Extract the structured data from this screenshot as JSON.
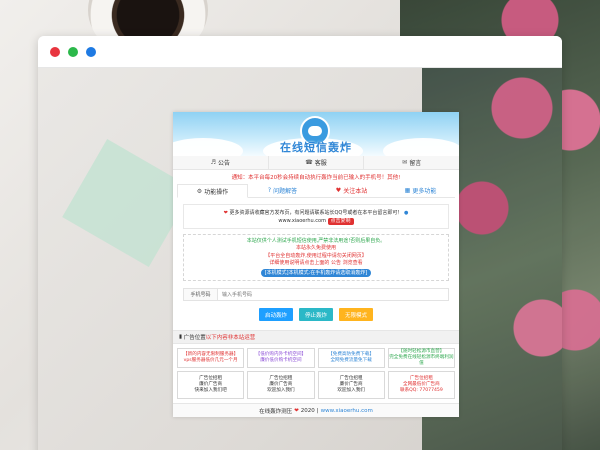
{
  "window": {
    "dots": [
      "#e8353f",
      "#2bb84a",
      "#1e7ae3"
    ]
  },
  "site": {
    "title": "在线短信轰炸",
    "nav": [
      {
        "icon": "megaphone-icon",
        "label": "公告"
      },
      {
        "icon": "headset-icon",
        "label": "客服"
      },
      {
        "icon": "chat-icon",
        "label": "留言"
      }
    ],
    "notice": "通知：本平台每20秒会持续自动执行轰炸当前已输入的手机号！其他!",
    "tabs": [
      {
        "label": "功能操作",
        "icon": "gear-icon"
      },
      {
        "label": "问题解答",
        "icon": "question-icon"
      },
      {
        "label": "关注本站",
        "icon": "heart-icon"
      },
      {
        "label": "更多功能",
        "icon": "grid-icon"
      }
    ],
    "info": {
      "line1": "更多资源请收藏官方发布页，有问题请联系站长QQ号或者在本平台留言即可！",
      "line2_url": "www.xiaoerhu.com",
      "badge": "点击复制"
    },
    "rules": {
      "line1": "本站仅供个人测试手机短信使用,严禁非法用途!否则后果自负。",
      "line2": "本站永久免费使用",
      "line3": "【平台全自动轰炸,使用过程中请勿关闭网页】",
      "line4": "详细使用说明请点击上面的 公告 浏览查看",
      "pill": "[本机模式]本机模式:在手机轰炸请选取消轰炸]"
    },
    "phone": {
      "label": "手机号码",
      "placeholder": "输入手机号码"
    },
    "buttons": {
      "start": "启动轰炸",
      "stop": "停止轰炸",
      "unlimited": "无限模式"
    },
    "ad_header": {
      "title": "广告位置",
      "sub": "以下内容非本站运营"
    },
    "ads": [
      {
        "lines": [
          "【新的内容无限制服务器】",
          "vps服务器低价几元一个月"
        ],
        "color": "#e03131"
      },
      {
        "lines": [
          "【低价购内外卡机空间】",
          "廉价低价购卡机空间"
        ],
        "color": "#8a4bd6"
      },
      {
        "lines": [
          "【免费高防免费下载】",
          "全网免费流量免下载"
        ],
        "color": "#2f86d6"
      },
      {
        "lines": [
          "【随时轻松源市直营】",
          "完全免费在线轻松源市终端利润值"
        ],
        "color": "#2fa84f"
      },
      {
        "lines": [
          "广告位招租",
          "廉价广告商",
          "快来加入我们吧"
        ],
        "color": "#333333"
      },
      {
        "lines": [
          "广告位招租",
          "廉价广告商",
          "欢迎加入我们"
        ],
        "color": "#333333"
      },
      {
        "lines": [
          "广告位招租",
          "廉价广告商",
          "欢迎加入我们"
        ],
        "color": "#333333"
      },
      {
        "lines": [
          "广告位招租",
          "全网最低价广告商",
          "联系QQ: 77077459"
        ],
        "color": "#e03131"
      }
    ],
    "footer": {
      "text": "在线轰炸测压",
      "year": "2020",
      "url": "www.xiaoerhu.com"
    }
  }
}
